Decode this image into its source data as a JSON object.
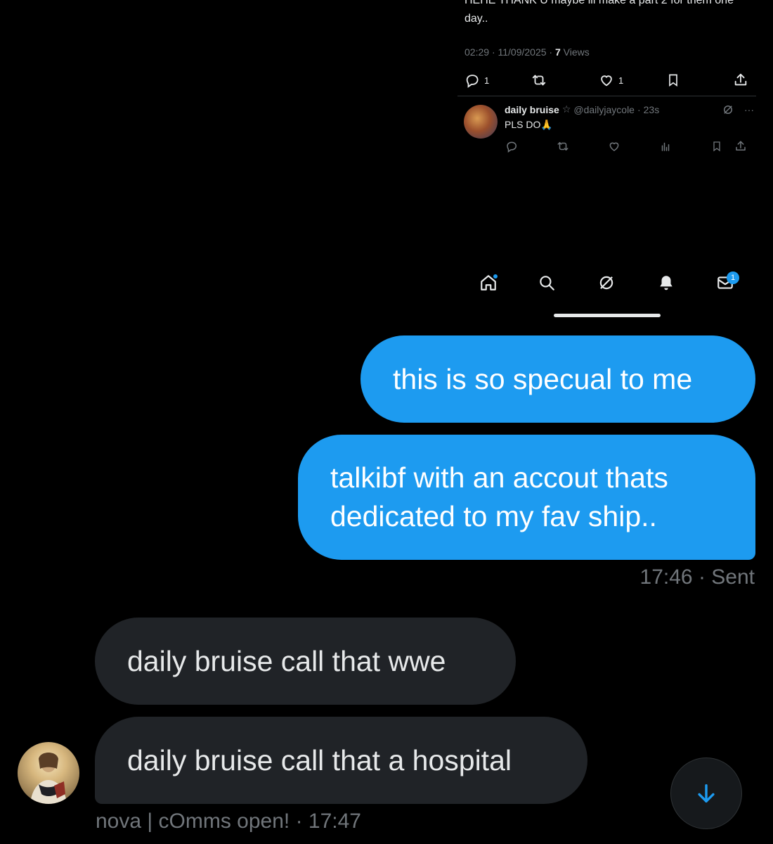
{
  "embedded_tweet": {
    "text": "HEHE THANK U maybe ill make a part 2 for them one day..",
    "time": "02:29",
    "date": "11/09/2025",
    "views_count": "7",
    "views_label": "Views",
    "reply_count": "1",
    "like_count": "1",
    "reply": {
      "name": "daily bruise",
      "star": "☆",
      "handle": "@dailyjaycole",
      "age": "23s",
      "text": "PLS DO🙏",
      "more": "···"
    },
    "nav": {
      "messages_badge": "1"
    }
  },
  "messages": [
    {
      "direction": "sent",
      "text": "this is so specual to me"
    },
    {
      "direction": "sent",
      "text": "talkibf with an accout thats dedicated to my fav ship.."
    },
    {
      "direction": "received",
      "text": "daily bruise call that wwe"
    },
    {
      "direction": "received",
      "text": "daily bruise call that a hospital"
    }
  ],
  "sent_status": "17:46 · Sent",
  "received_status": "nova | cOmms open! · 17:47",
  "colors": {
    "accent": "#1d9bf0",
    "received_bubble": "#202327",
    "muted_text": "#71767b"
  }
}
